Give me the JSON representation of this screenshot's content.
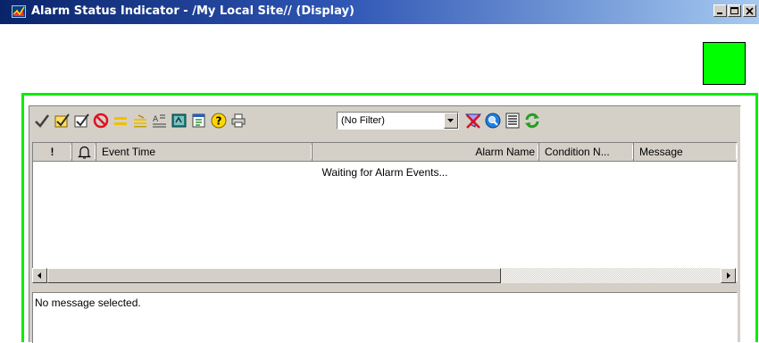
{
  "window": {
    "title": "Alarm Status Indicator - /My Local Site// (Display)",
    "minimize_label": "_",
    "close_label": "x"
  },
  "status_indicator": {
    "color": "#00ff00"
  },
  "frame": {
    "border_color": "#00ee00"
  },
  "toolbar": {
    "icons": [
      "acknowledge-icon",
      "acknowledge-all-icon",
      "acknowledge-selected-icon",
      "disable-icon",
      "suppress-icon",
      "shelve-icon",
      "comment-icon",
      "freeze-icon",
      "properties-icon",
      "help-icon",
      "print-icon"
    ],
    "filter": {
      "selected": "(No Filter)"
    },
    "icons_right": [
      "clear-filter-icon",
      "search-icon",
      "list-icon",
      "refresh-icon"
    ]
  },
  "alarm_list": {
    "columns": {
      "priority": "!",
      "bell": "🔔",
      "event_time": "Event Time",
      "alarm_name": "Alarm Name",
      "condition_name": "Condition N...",
      "message": "Message"
    },
    "placeholder": "Waiting for Alarm Events..."
  },
  "details": {
    "text": "No message selected."
  }
}
